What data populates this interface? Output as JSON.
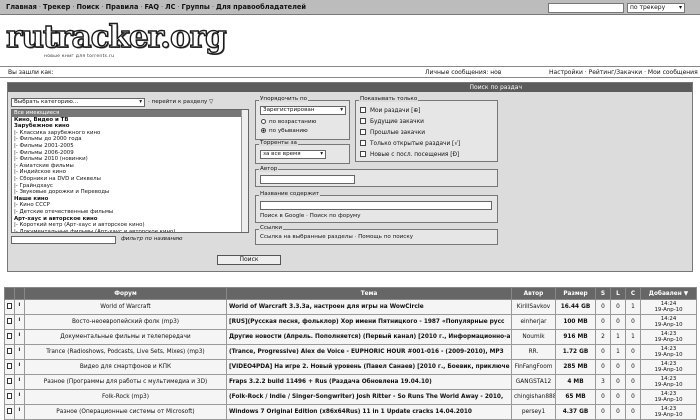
{
  "topnav": {
    "items": [
      "Главная",
      "Трекер",
      "Поиск",
      "Правила",
      "FAQ",
      "ЛС",
      "Группы",
      "Для правообладателей"
    ],
    "search_value": "",
    "search_scope": "по трекеру"
  },
  "logo": {
    "text": "rutracker.org",
    "tagline": "новые книг для torrents.ru"
  },
  "userbar": {
    "welcome": "Вы зашли как:",
    "messages": "Личные сообщения: нов",
    "links": "Настройки · Рейтинг/Закачки · Мои сообщения"
  },
  "search": {
    "title": "Поиск по раздач",
    "category_select": "Выбрать категорию...",
    "by_section": "· перейти к разделу ▽",
    "categories": [
      {
        "label": "Все имеющиеся",
        "bold": false,
        "selected": true
      },
      {
        "label": "Кино, Видео и ТВ",
        "bold": true,
        "selected": false
      },
      {
        "label": "Зарубежное кино",
        "bold": true,
        "selected": false
      },
      {
        "label": "|- Классика зарубежного кино",
        "bold": false,
        "selected": false
      },
      {
        "label": "|- Фильмы до 2000 года",
        "bold": false,
        "selected": false
      },
      {
        "label": "|- Фильмы 2001-2005",
        "bold": false,
        "selected": false
      },
      {
        "label": "|- Фильмы 2006-2009",
        "bold": false,
        "selected": false
      },
      {
        "label": "|- Фильмы 2010 (новинки)",
        "bold": false,
        "selected": false
      },
      {
        "label": "|- Азиатские фильмы",
        "bold": false,
        "selected": false
      },
      {
        "label": "|- Индийское кино",
        "bold": false,
        "selected": false
      },
      {
        "label": "|- Сборники на DVD и Сиквелы",
        "bold": false,
        "selected": false
      },
      {
        "label": "|- Грайндхаус",
        "bold": false,
        "selected": false
      },
      {
        "label": "|- Звуковые дорожки и Переводы",
        "bold": false,
        "selected": false
      },
      {
        "label": "Наше кино",
        "bold": true,
        "selected": false
      },
      {
        "label": "|- Кино СССР",
        "bold": false,
        "selected": false
      },
      {
        "label": "|- Детские отечественные фильмы",
        "bold": false,
        "selected": false
      },
      {
        "label": "Арт-хаус и авторское кино",
        "bold": true,
        "selected": false
      },
      {
        "label": "|- Короткий метр (Арт-хаус и авторское кино)",
        "bold": false,
        "selected": false
      },
      {
        "label": "|- Документальные фильмы (Арт-хаус и авторское кино)",
        "bold": false,
        "selected": false
      }
    ],
    "filter_label": "фильтр по названию",
    "order_label": "Упорядочить по",
    "order_select": "Зарегистрирован",
    "order_asc": "по возрастанию",
    "order_desc": "по убыванию",
    "period_label": "Торренты за",
    "period_select": "за все время",
    "author_label": "Автор",
    "title_contains_label": "Название содержит",
    "title_links": "Поиск в Google · Поиск по форуму",
    "links_label": "Ссылки",
    "links_text": "Ссылка на выбранные разделы · Помощь по поиску",
    "show_only_label": "Показывать только",
    "show_only": [
      "Мои раздачи [⊕]",
      "Будущие закачки",
      "Прошлые закачки",
      "Только открытые раздачи [√]",
      "Новые с посл. посещения [Ð]"
    ],
    "button": "Поиск"
  },
  "results": {
    "headers": [
      "",
      "",
      "Форум",
      "Тема",
      "Автор",
      "Размер",
      "S",
      "L",
      "C",
      "Добавлен ▼"
    ],
    "rows": [
      {
        "forum": "World of Warcraft",
        "topic": "World of Warcraft 3.3.3a, настроен для игры на WowCircle",
        "author": "KirillSavkov",
        "size": "16.44 GB",
        "s": "0",
        "l": "0",
        "c": "1",
        "time": "14:24",
        "date": "19-Anp-10"
      },
      {
        "forum": "Восто-неоевропейский фолк (mp3)",
        "topic": "[RUS](Русская песня, фольклор) Хор имени Пятницкого - 1987 «Популярные русс",
        "author": "einherjar",
        "size": "100 MB",
        "s": "0",
        "l": "0",
        "c": "0",
        "time": "14:24",
        "date": "19-Anp-10"
      },
      {
        "forum": "Документальные фильмы и телепередачи",
        "topic": "Другие новости (Апрель. Пополняется) (Первый канал) [2010 г., Информационно-а",
        "author": "Noumik",
        "size": "916 MB",
        "s": "2",
        "l": "1",
        "c": "1",
        "time": "14:23",
        "date": "19-Anp-10"
      },
      {
        "forum": "Trance (Radioshows, Podcasts, Live Sets, Mixes) (mp3)",
        "topic": "(Trance, Progressive) Alex de Voice - EUPHORIC HOUR #001-016 - (2009-2010), MP3",
        "author": "RR.",
        "size": "1.72 GB",
        "s": "0",
        "l": "1",
        "c": "0",
        "time": "14:23",
        "date": "19-Anp-10"
      },
      {
        "forum": "Видео для смартфонов и КПК",
        "topic": "[VIDEO4PDA] На игре 2. Новый уровень (Павел Санаев) [2010 г., Боевик, приключе",
        "author": "FinFangFoom",
        "size": "285 MB",
        "s": "0",
        "l": "0",
        "c": "0",
        "time": "14:23",
        "date": "19-Anp-10"
      },
      {
        "forum": "Разное (Программы для работы с мультимедиа и 3D)",
        "topic": "Fraps 3.2.2 build 11496 + Rus (Раздача Обновлена 19.04.10)",
        "author": "GANGSTA12",
        "size": "4 MB",
        "s": "3",
        "l": "0",
        "c": "0",
        "time": "14:23",
        "date": "19-Anp-10"
      },
      {
        "forum": "Folk-Rock (mp3)",
        "topic": "(Folk-Rock / Indie / Singer-Songwriter) Josh Ritter - So Runs The World Away - 2010,",
        "author": "chingishan888",
        "size": "65 MB",
        "s": "0",
        "l": "0",
        "c": "0",
        "time": "14:23",
        "date": "19-Anp-10"
      },
      {
        "forum": "Разное (Операционные системы от Microsoft)",
        "topic": "Windows 7 Original Edition (x86x64Rus) 11 in 1 Update cracks 14.04.2010",
        "author": "persey1",
        "size": "4.37 GB",
        "s": "0",
        "l": "0",
        "c": "0",
        "time": "14:23",
        "date": "19-Anp-10"
      }
    ]
  }
}
